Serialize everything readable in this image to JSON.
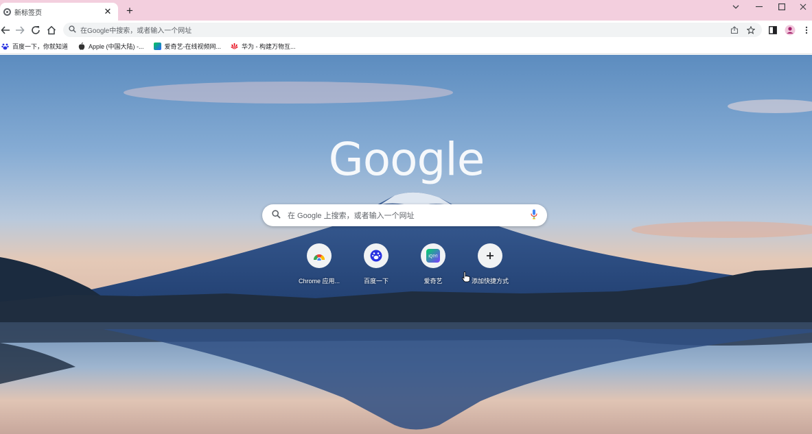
{
  "tab": {
    "title": "新标签页",
    "close_glyph": "✕",
    "favicon": "chrome-icon"
  },
  "new_tab_glyph": "+",
  "window_controls": {
    "dropdown": "⌄",
    "minimize": "—",
    "maximize": "☐",
    "close": "✕"
  },
  "toolbar": {
    "omnibox_placeholder": "在Google中搜索，或者输入一个网址",
    "icons": [
      "back-icon",
      "forward-icon",
      "reload-icon",
      "home-icon",
      "share-icon",
      "star-icon",
      "sidepanel-icon",
      "profile-icon",
      "menu-icon"
    ]
  },
  "bookmarks": [
    {
      "label": "百度一下，你就知道",
      "icon": "baidu-icon"
    },
    {
      "label": "Apple (中国大陆) -...",
      "icon": "apple-icon"
    },
    {
      "label": "爱奇艺-在线视频网...",
      "icon": "iqiyi-icon"
    },
    {
      "label": "华为 - 构建万物互...",
      "icon": "huawei-icon"
    }
  ],
  "logo": "Google",
  "search": {
    "placeholder": "在 Google 上搜索，或者输入一个网址"
  },
  "shortcuts": [
    {
      "label": "Chrome 应用...",
      "icon": "chrome-webstore-icon"
    },
    {
      "label": "百度一下",
      "icon": "baidu-icon"
    },
    {
      "label": "爱奇艺",
      "icon": "iqiyi-icon",
      "badge": "iQIYI"
    },
    {
      "label": "添加快捷方式",
      "icon": "plus-icon",
      "glyph": "+"
    }
  ],
  "colors": {
    "titlebar": "#f3cfde",
    "omnibox": "#f1f3f4",
    "sky_top": "#5f8fc0",
    "mountain": "#2a4f86"
  }
}
